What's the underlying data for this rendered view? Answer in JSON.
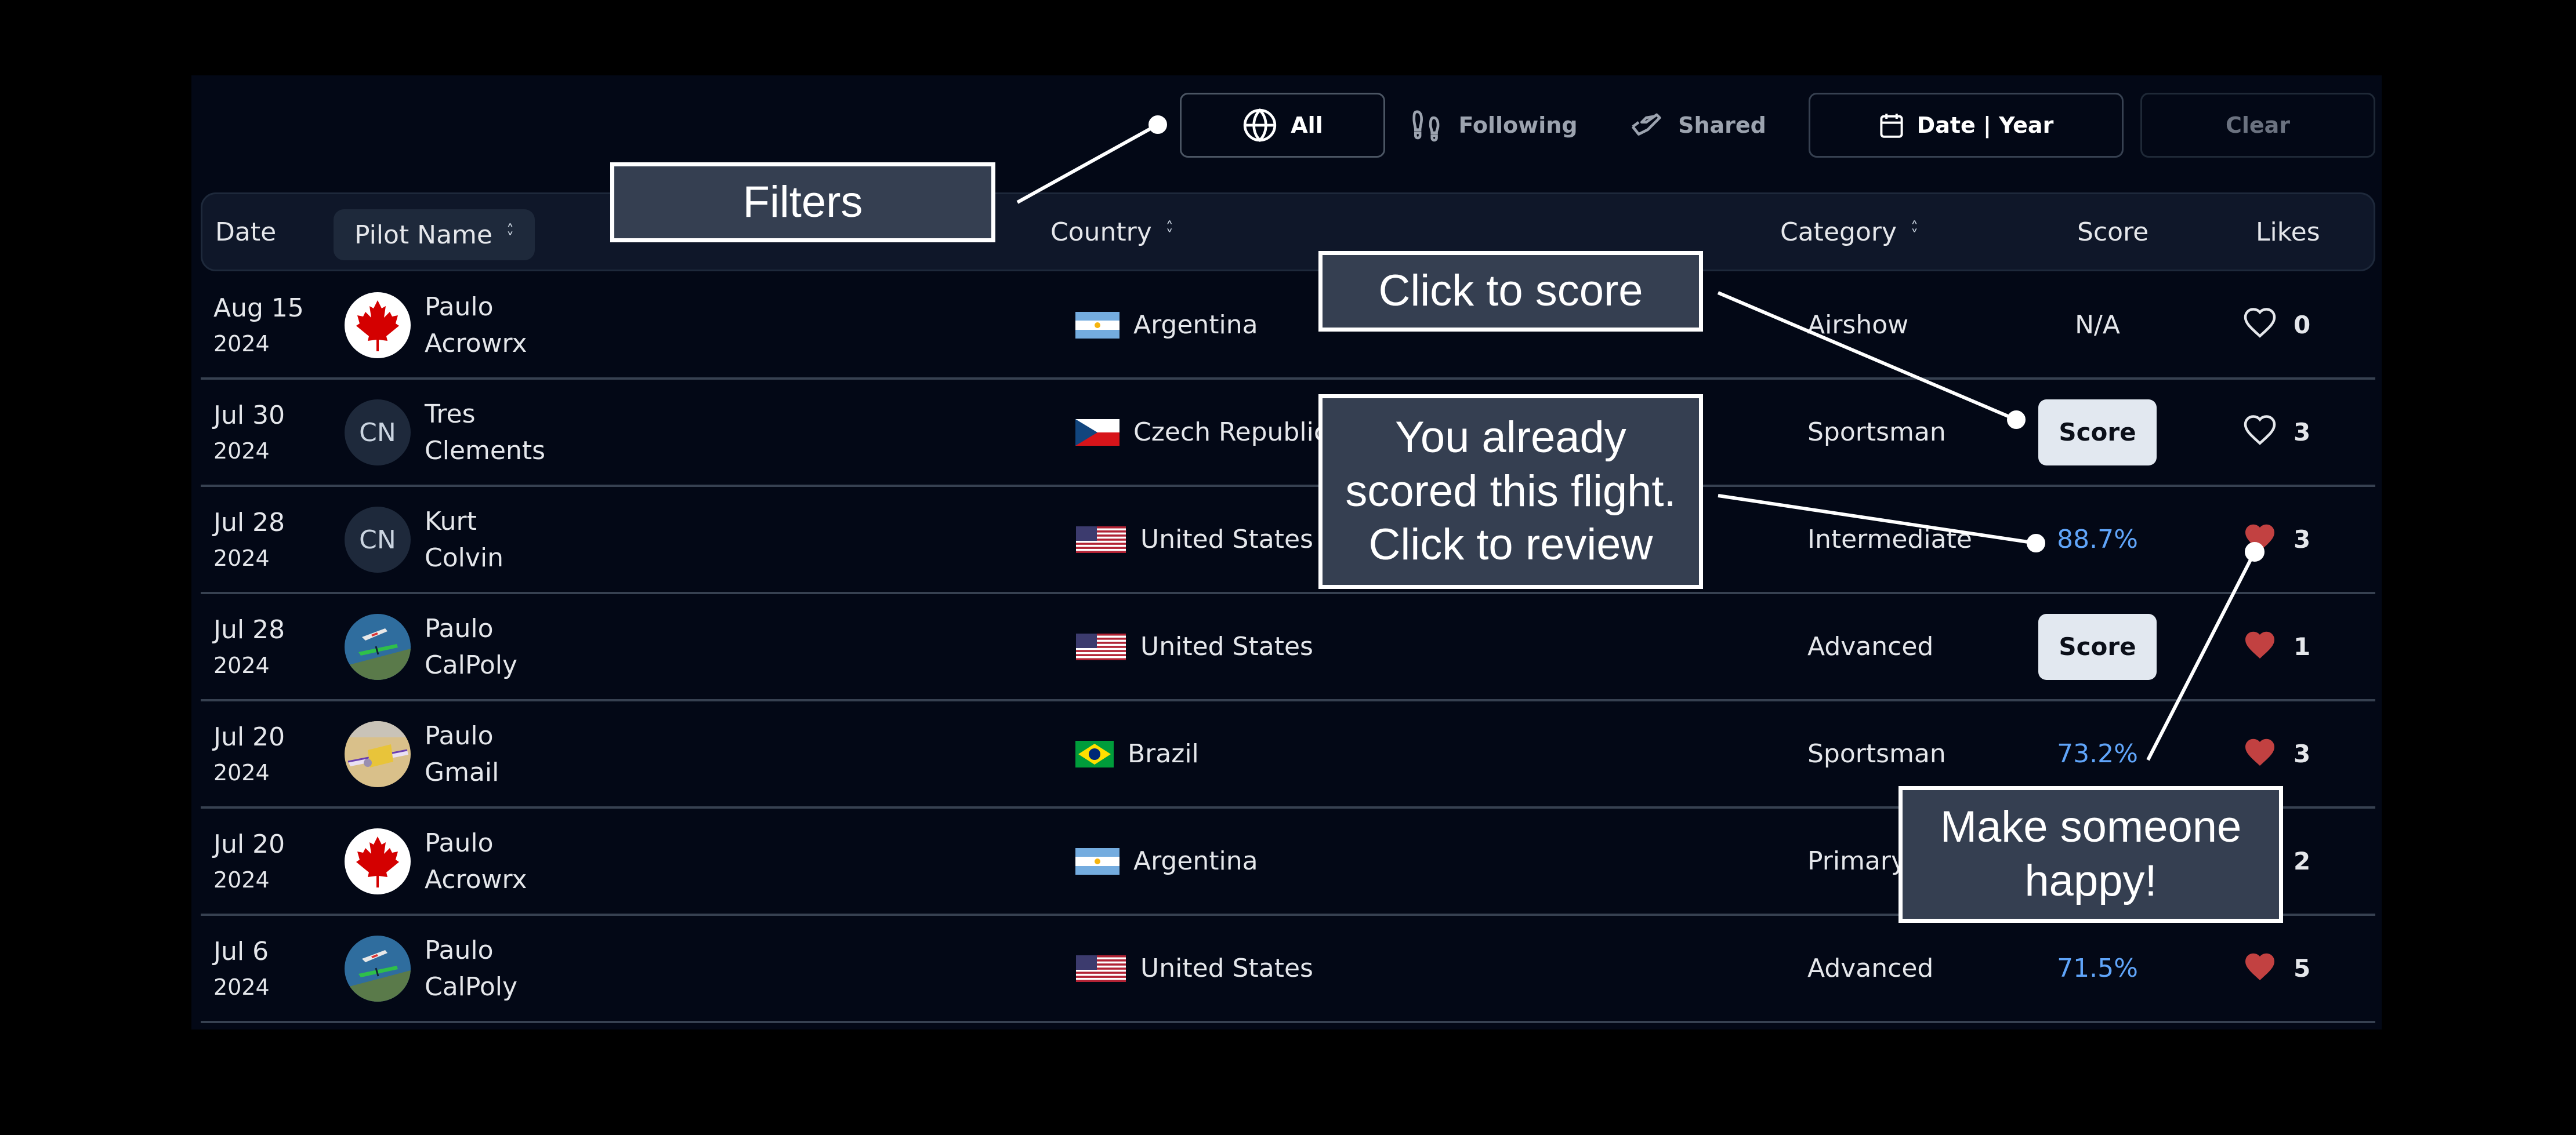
{
  "filters": {
    "all": {
      "label": "All",
      "icon": "globe-icon"
    },
    "following": {
      "label": "Following",
      "icon": "footprints-icon"
    },
    "shared": {
      "label": "Shared",
      "icon": "handshake-icon"
    },
    "date_year": {
      "label": "Date | Year",
      "icon": "calendar-icon"
    },
    "clear": {
      "label": "Clear"
    }
  },
  "columns": {
    "date": "Date",
    "pilot_name": "Pilot Name",
    "country": "Country",
    "category": "Category",
    "score": "Score",
    "likes": "Likes",
    "sort_icon": "sort-updown-icon"
  },
  "rows": [
    {
      "date": "Aug 15",
      "year": "2024",
      "avatar": "canada-flag-avatar",
      "avatar_initials": "",
      "first": "Paulo",
      "last": "Acrowrx",
      "country": "Argentina",
      "flag": "argentina",
      "category": "Airshow",
      "score_type": "text",
      "score": "N/A",
      "liked": false,
      "likes": "0"
    },
    {
      "date": "Jul 30",
      "year": "2024",
      "avatar": "initials",
      "avatar_initials": "CN",
      "first": "Tres",
      "last": "Clements",
      "country": "Czech Republic",
      "flag": "czech",
      "category": "Sportsman",
      "score_type": "button",
      "score": "Score",
      "liked": false,
      "likes": "3"
    },
    {
      "date": "Jul 28",
      "year": "2024",
      "avatar": "initials",
      "avatar_initials": "CN",
      "first": "Kurt",
      "last": "Colvin",
      "country": "United States",
      "flag": "usa",
      "category": "Intermediate",
      "score_type": "percent",
      "score": "88.7%",
      "liked": true,
      "likes": "3"
    },
    {
      "date": "Jul 28",
      "year": "2024",
      "avatar": "planes-photo-avatar",
      "avatar_initials": "",
      "first": "Paulo",
      "last": "CalPoly",
      "country": "United States",
      "flag": "usa",
      "category": "Advanced",
      "score_type": "button",
      "score": "Score",
      "liked": true,
      "likes": "1"
    },
    {
      "date": "Jul 20",
      "year": "2024",
      "avatar": "yellow-plane-avatar",
      "avatar_initials": "",
      "first": "Paulo",
      "last": "Gmail",
      "country": "Brazil",
      "flag": "brazil",
      "category": "Sportsman",
      "score_type": "percent",
      "score": "73.2%",
      "liked": true,
      "likes": "3"
    },
    {
      "date": "Jul 20",
      "year": "2024",
      "avatar": "canada-flag-avatar",
      "avatar_initials": "",
      "first": "Paulo",
      "last": "Acrowrx",
      "country": "Argentina",
      "flag": "argentina",
      "category": "Primary",
      "score_type": "hidden",
      "score": "",
      "liked": true,
      "likes": "2"
    },
    {
      "date": "Jul 6",
      "year": "2024",
      "avatar": "planes-photo-avatar",
      "avatar_initials": "",
      "first": "Paulo",
      "last": "CalPoly",
      "country": "United States",
      "flag": "usa",
      "category": "Advanced",
      "score_type": "percent",
      "score": "71.5%",
      "liked": true,
      "likes": "5"
    }
  ],
  "callouts": {
    "filters": "Filters",
    "click_to_score": "Click to score",
    "already_scored": [
      "You already",
      "scored this flight.",
      "Click to review"
    ],
    "make_happy": [
      "Make someone",
      "happy!"
    ]
  },
  "colors": {
    "page_bg": "#000000",
    "panel_bg": "#030816",
    "header_bg": "#0f1729",
    "score_link": "#60a5fa",
    "heart_liked": "#c24141",
    "score_button_bg": "#e2e8f0",
    "callout_bg": "#353f51"
  }
}
